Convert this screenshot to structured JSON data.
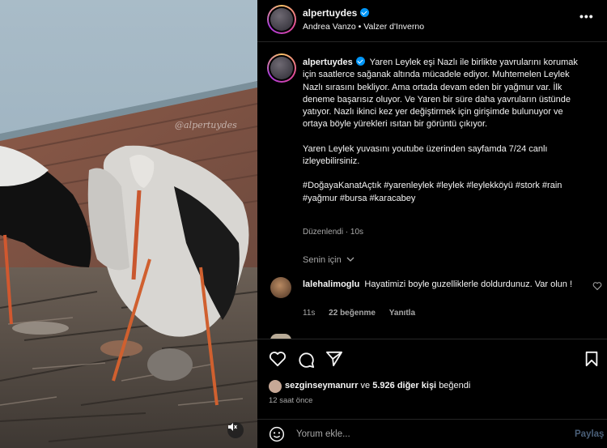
{
  "header": {
    "username": "alpertuydes",
    "audio": "Andrea Vanzo • Valzer d'Inverno",
    "more_label": "•••"
  },
  "media": {
    "watermark": "@alpertuydes"
  },
  "caption": {
    "username": "alpertuydes",
    "paragraph1": "Yaren Leylek eşi Nazlı ile birlikte yavrularını korumak için saatlerce sağanak altında mücadele ediyor. Muhtemelen Leylek Nazlı sırasını bekliyor. Ama ortada devam eden bir yağmur var. İlk deneme başarısız oluyor. Ve Yaren bir süre daha yavruların üstünde yatıyor. Nazlı ikinci kez yer değiştirmek için girişimde bulunuyor ve ortaya böyle yürekleri ısıtan bir görüntü çıkıyor.",
    "paragraph2": "Yaren Leylek yuvasını youtube üzerinden sayfamda 7/24 canlı izleyebilirsiniz.",
    "hashtags": "#DoğayaKanatAçtık #yarenleylek #leylek #leylekköyü #stork #rain #yağmur #bursa #karacabey",
    "edited": "Düzenlendi · 10s"
  },
  "for_you": "Senin için",
  "comment": {
    "username": "lalehalimoglu",
    "text": "Hayatimizi boyle guzelliklerle doldurdunuz. Var olun !",
    "time": "11s",
    "likes": "22 beğenme",
    "reply": "Yanıtla"
  },
  "likes": {
    "first": "sezginseymanurr",
    "connector": "ve",
    "others": "5.926 diğer kişi",
    "suffix": "beğendi"
  },
  "time_ago": "12 saat önce",
  "add_comment": {
    "placeholder": "Yorum ekle...",
    "share": "Paylaş"
  },
  "colors": {
    "background": "#000000",
    "verified": "#0095f6",
    "muted_text": "#a8a8a8",
    "share_disabled": "#4a5f78"
  }
}
